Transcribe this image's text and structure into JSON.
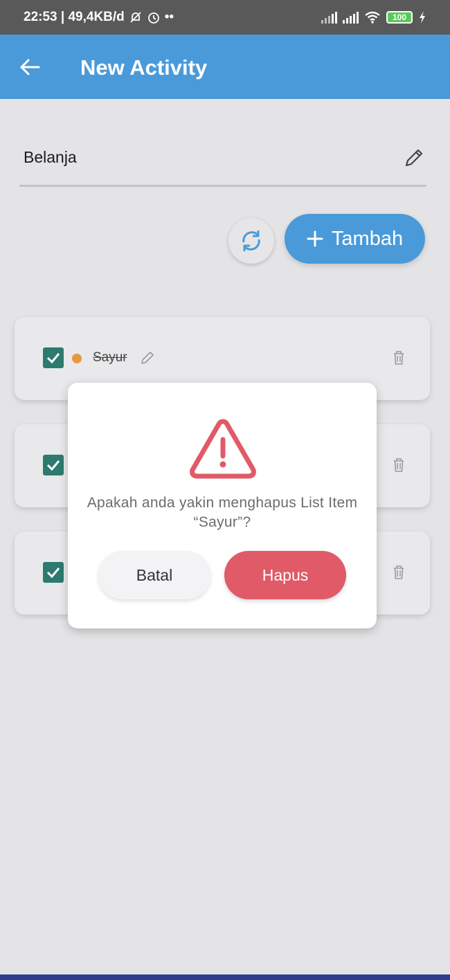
{
  "status_bar": {
    "time_info": "22:53 | 49,4KB/d",
    "extra_icons": "••",
    "battery": "100"
  },
  "app_bar": {
    "title": "New Activity"
  },
  "activity": {
    "title_value": "Belanja"
  },
  "actions": {
    "add_label": "Tambah"
  },
  "list": {
    "items": [
      {
        "label": "Sayur",
        "checked": true,
        "dot_color": "#e59a3e"
      },
      {
        "label": "",
        "checked": true
      },
      {
        "label": "",
        "checked": true
      }
    ]
  },
  "dialog": {
    "message": "Apakah anda yakin menghapus List Item “Sayur”?",
    "cancel_label": "Batal",
    "confirm_label": "Hapus"
  },
  "colors": {
    "primary": "#4a9ad9",
    "danger": "#e05a67",
    "checkbox": "#2d7a6f",
    "warning": "#e05a67"
  }
}
